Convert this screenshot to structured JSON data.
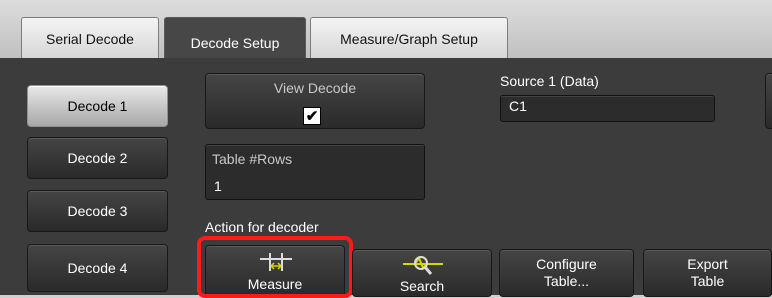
{
  "tabs": [
    {
      "label": "Serial Decode"
    },
    {
      "label": "Decode Setup"
    },
    {
      "label": "Measure/Graph Setup"
    }
  ],
  "decodes": [
    {
      "label": "Decode 1",
      "selected": true
    },
    {
      "label": "Decode 2"
    },
    {
      "label": "Decode 3"
    },
    {
      "label": "Decode 4"
    }
  ],
  "view_decode": {
    "label": "View Decode",
    "checked": true,
    "check_glyph": "✔"
  },
  "source": {
    "label": "Source 1 (Data)",
    "value": "C1"
  },
  "table_rows": {
    "label": "Table #Rows",
    "value": "1"
  },
  "action_label": "Action for decoder",
  "actions": {
    "measure": "Measure",
    "search": "Search",
    "configure_line1": "Configure",
    "configure_line2": "Table...",
    "export_line1": "Export",
    "export_line2": "Table"
  },
  "colors": {
    "highlight": "#ff1a1a",
    "active_tab": "#474747",
    "panel": "#3c3c3c",
    "icon": "#d8d800"
  }
}
